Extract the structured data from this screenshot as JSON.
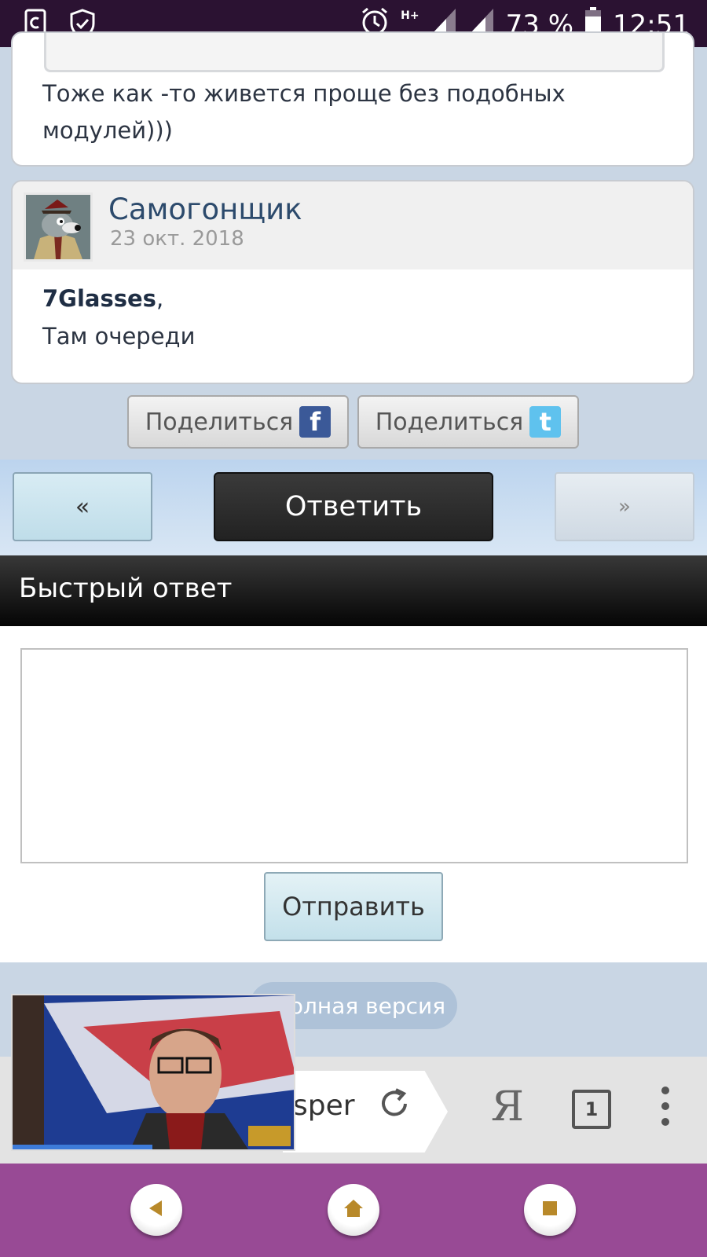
{
  "status_bar": {
    "battery_percent": "73 %",
    "time": "12:51",
    "network_label": "H+"
  },
  "previous_post": {
    "text_line1": "Тоже как -то живется проще без подобных",
    "text_line2": "модулей)))"
  },
  "post": {
    "username": "Самогонщик",
    "date": "23 окт. 2018",
    "mention": "7Glasses",
    "mention_suffix": ",",
    "body": "Там очереди"
  },
  "share": {
    "facebook_label": "Поделиться",
    "twitter_label": "Поделиться",
    "facebook_icon": "f",
    "twitter_icon": "t"
  },
  "navigation": {
    "prev_label": "«",
    "reply_label": "Ответить",
    "next_label": "»"
  },
  "quick_reply": {
    "title": "Быстрый ответ",
    "textarea_value": "",
    "send_label": "Отправить"
  },
  "footer": {
    "full_version_label": "олная версия"
  },
  "browser": {
    "url_fragment": "sper",
    "yandex_label": "Я",
    "tabs_count": "1"
  },
  "colors": {
    "status_bar_bg": "#2b1232",
    "nav_bar_bg": "#984a95",
    "accent_username": "#2c4a6c"
  }
}
